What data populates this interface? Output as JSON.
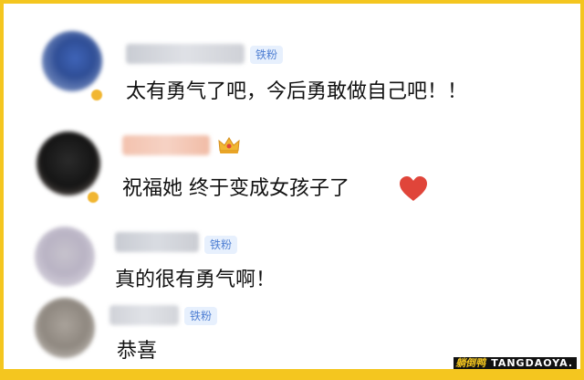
{
  "comments": [
    {
      "badge": "铁粉",
      "text": "太有勇气了吧，今后勇敢做自己吧！！"
    },
    {
      "badge": "",
      "text": "祝福她  终于变成女孩子了"
    },
    {
      "badge": "铁粉",
      "text": "真的很有勇气啊！"
    },
    {
      "badge": "铁粉",
      "text": "恭喜"
    }
  ],
  "watermark": {
    "brand": "躺倒鸭",
    "site": "TANGDAOYA."
  },
  "colors": {
    "frame": "#f4c61f",
    "badge_bg": "#e7f0fd",
    "badge_text": "#4f7fd3",
    "heart": "#e0453a"
  },
  "icons": {
    "crown": "crown-icon",
    "heart": "heart-icon"
  }
}
